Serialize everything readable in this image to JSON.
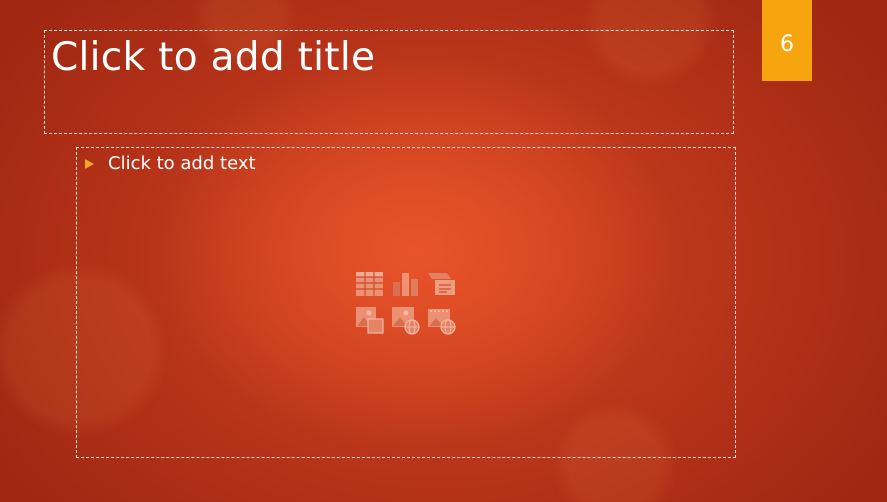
{
  "slide": {
    "title_placeholder": "Click to add title",
    "body_placeholder": "Click to add text",
    "slide_number": "6"
  },
  "colors": {
    "background": "#c23a1c",
    "accent_tab": "#f6a50e",
    "bullet": "#f5a623",
    "text": "#ffffff"
  },
  "insert_icons": [
    {
      "name": "insert-table-icon"
    },
    {
      "name": "insert-chart-icon"
    },
    {
      "name": "insert-smartart-icon"
    },
    {
      "name": "insert-pictures-icon"
    },
    {
      "name": "insert-online-pictures-icon"
    },
    {
      "name": "insert-video-icon"
    }
  ]
}
